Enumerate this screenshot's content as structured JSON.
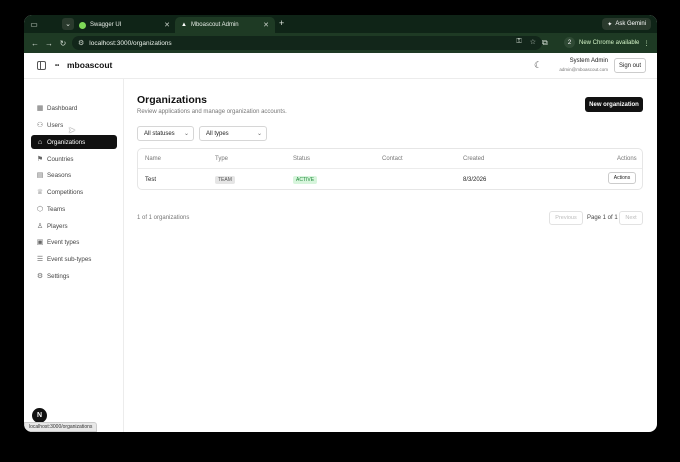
{
  "browser": {
    "tabs": [
      {
        "label": "Swagger UI",
        "favicon_color": "#7ed957"
      },
      {
        "label": "Mboascout Admin",
        "favicon_color": "#ffffff"
      }
    ],
    "ask_gemini": "Ask Gemini",
    "url": "localhost:3000/organizations",
    "profile_initial": "2",
    "new_chrome": "New Chrome available"
  },
  "header": {
    "brand": "mboascout",
    "user_name": "System Admin",
    "user_email": "admin@mboascout.com",
    "sign_out": "Sign out"
  },
  "sidebar": {
    "items": [
      {
        "label": "Dashboard",
        "icon": "grid-icon"
      },
      {
        "label": "Users",
        "icon": "users-icon"
      },
      {
        "label": "Organizations",
        "icon": "home-icon",
        "active": true
      },
      {
        "label": "Countries",
        "icon": "flag-icon"
      },
      {
        "label": "Seasons",
        "icon": "calendar-icon"
      },
      {
        "label": "Competitions",
        "icon": "trophy-icon"
      },
      {
        "label": "Teams",
        "icon": "shield-icon"
      },
      {
        "label": "Players",
        "icon": "user-icon"
      },
      {
        "label": "Event types",
        "icon": "calendar-check-icon"
      },
      {
        "label": "Event sub-types",
        "icon": "list-icon"
      },
      {
        "label": "Settings",
        "icon": "gear-icon"
      }
    ],
    "badge": "N",
    "status_url": "localhost:3000/organizations"
  },
  "main": {
    "title": "Organizations",
    "subtitle": "Review applications and manage organization accounts.",
    "new_button": "New organization",
    "filters": {
      "status": "All statuses",
      "type": "All types"
    },
    "columns": [
      "Name",
      "Type",
      "Status",
      "Contact",
      "Created",
      "Actions"
    ],
    "rows": [
      {
        "name": "Test",
        "type": "TEAM",
        "status": "ACTIVE",
        "contact": "",
        "created": "8/3/2026",
        "actions": "Actions"
      }
    ],
    "count_text": "1 of 1 organizations",
    "pagination": {
      "prev": "Previous",
      "info": "Page 1 of 1",
      "next": "Next"
    }
  }
}
